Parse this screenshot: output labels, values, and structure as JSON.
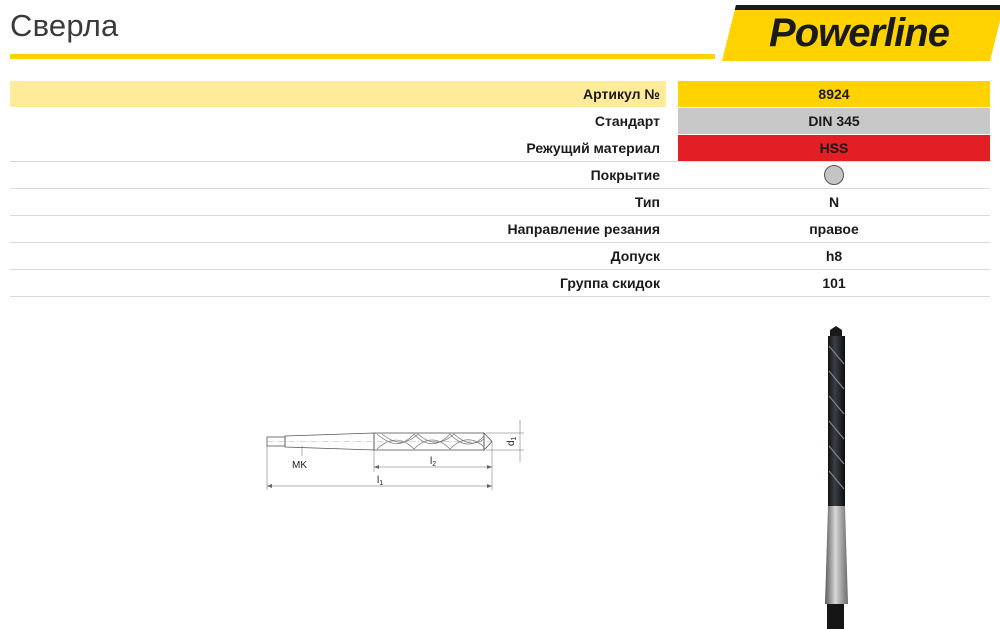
{
  "header": {
    "title": "Сверла",
    "logo_text": "Powerline",
    "accent_color": "#ffd200"
  },
  "spec_rows": [
    {
      "label": "Артикул №",
      "value": "8924"
    },
    {
      "label": "Стандарт",
      "value": "DIN 345"
    },
    {
      "label": "Режущий материал",
      "value": "HSS"
    },
    {
      "label": "Покрытие",
      "value": ""
    },
    {
      "label": "Тип",
      "value": "N"
    },
    {
      "label": "Направление резания",
      "value": "правое"
    },
    {
      "label": "Допуск",
      "value": "h8"
    },
    {
      "label": "Группа скидок",
      "value": "101"
    }
  ],
  "colors": {
    "article_value_bg": "#ffd200",
    "article_label_bg": "#ffeb99",
    "standard_bg": "#c8c8c8",
    "material_bg": "#e31e24",
    "coating_dot": "#c4c4c4"
  },
  "coating": {
    "icon": "grey-circle-icon"
  },
  "drawing": {
    "mk": "MK",
    "l1": "l",
    "l1_sub": "1",
    "l2": "l",
    "l2_sub": "2",
    "d1": "d",
    "d1_sub": "1"
  }
}
